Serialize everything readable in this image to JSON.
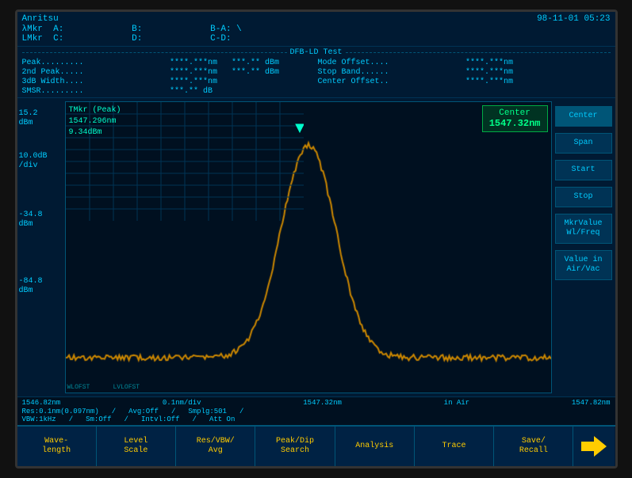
{
  "brand": "Anritsu",
  "datetime": "98-11-01 05:23",
  "markers": {
    "lambda_mkr_a": "A:",
    "lambda_mkr_b": "B:",
    "lambda_mkr_ba": "B-A:",
    "l_mkr_c": "C:",
    "l_mkr_d": "D:",
    "l_mkr_cd": "C-D:"
  },
  "dfb_test": {
    "title": "DFB-LD Test",
    "rows": [
      {
        "label": "Peak.........",
        "val1": "****.***nm",
        "val2": "***.** dBm",
        "label2": "Mode Offset....",
        "val3": "****.***nm"
      },
      {
        "label": "2nd Peak.....",
        "val1": "****.***nm",
        "val2": "***.** dBm",
        "label2": "Stop Band......",
        "val3": "****.***nm"
      },
      {
        "label": "3dB Width....",
        "val1": "****.***nm",
        "val2": "",
        "label2": "Center Offset..",
        "val3": "****.***nm"
      },
      {
        "label": "SMSR.........",
        "val1": "***.** dB",
        "val2": "",
        "label2": "",
        "val3": ""
      }
    ]
  },
  "chart": {
    "tmkr_label": "TMkr (Peak)",
    "tmkr_wl": "1547.296nm",
    "tmkr_level": "9.34dBm",
    "center_label": "Center",
    "center_value": "1547.32nm",
    "ref_level": "15.2",
    "ref_unit": "dBm",
    "scale": "10.0dB",
    "scale_unit": "/div",
    "low_level": "-34.8",
    "low_unit": "dBm",
    "bottom_level": "-84.8",
    "bottom_unit": "dBm",
    "x_start": "1546.82nm",
    "x_div": "0.1nm/div",
    "x_center": "1547.32nm",
    "x_medium": "in Air",
    "x_end": "1547.82nm",
    "wl_ofst": "WLOFST",
    "lvl_ofst": "LVLOFST"
  },
  "status": {
    "res": "Res:0.1nm(0.097nm)",
    "vbw": "VBW:1kHz",
    "avg": "Avg:Off",
    "sm": "Sm:Off",
    "intvl": "Intvl:Off",
    "smplg": "Smplg:501",
    "att": "Att On"
  },
  "right_buttons": [
    {
      "label": "Center",
      "active": true
    },
    {
      "label": "Span",
      "active": false
    },
    {
      "label": "Start",
      "active": false
    },
    {
      "label": "Stop",
      "active": false
    },
    {
      "label": "MkrValue\nWl/Freq",
      "active": false
    },
    {
      "label": "Value in\nAir/Vac",
      "active": false
    }
  ],
  "bottom_buttons": [
    {
      "label": "Wave-\nlength",
      "active": false
    },
    {
      "label": "Level\nScale",
      "active": false
    },
    {
      "label": "Res/VBW/\nAvg",
      "active": false
    },
    {
      "label": "Peak/Dip\nSearch",
      "active": false
    },
    {
      "label": "Analysis",
      "active": false
    },
    {
      "label": "Trace",
      "active": false
    },
    {
      "label": "Save/\nRecall",
      "active": false
    }
  ]
}
